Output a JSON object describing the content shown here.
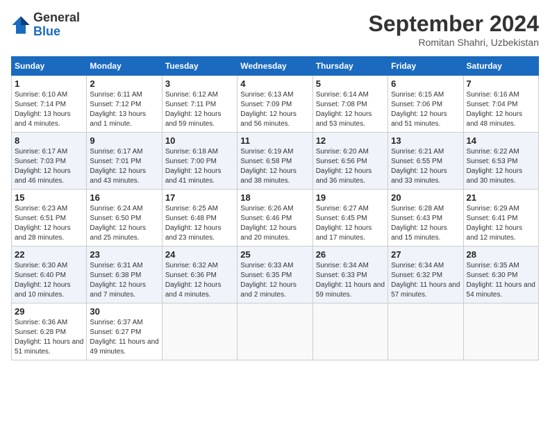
{
  "header": {
    "logo_general": "General",
    "logo_blue": "Blue",
    "month_title": "September 2024",
    "location": "Romitan Shahri, Uzbekistan"
  },
  "calendar": {
    "days_of_week": [
      "Sunday",
      "Monday",
      "Tuesday",
      "Wednesday",
      "Thursday",
      "Friday",
      "Saturday"
    ],
    "weeks": [
      [
        {
          "day": "1",
          "sunrise": "6:10 AM",
          "sunset": "7:14 PM",
          "daylight": "13 hours and 4 minutes."
        },
        {
          "day": "2",
          "sunrise": "6:11 AM",
          "sunset": "7:12 PM",
          "daylight": "13 hours and 1 minute."
        },
        {
          "day": "3",
          "sunrise": "6:12 AM",
          "sunset": "7:11 PM",
          "daylight": "12 hours and 59 minutes."
        },
        {
          "day": "4",
          "sunrise": "6:13 AM",
          "sunset": "7:09 PM",
          "daylight": "12 hours and 56 minutes."
        },
        {
          "day": "5",
          "sunrise": "6:14 AM",
          "sunset": "7:08 PM",
          "daylight": "12 hours and 53 minutes."
        },
        {
          "day": "6",
          "sunrise": "6:15 AM",
          "sunset": "7:06 PM",
          "daylight": "12 hours and 51 minutes."
        },
        {
          "day": "7",
          "sunrise": "6:16 AM",
          "sunset": "7:04 PM",
          "daylight": "12 hours and 48 minutes."
        }
      ],
      [
        {
          "day": "8",
          "sunrise": "6:17 AM",
          "sunset": "7:03 PM",
          "daylight": "12 hours and 46 minutes."
        },
        {
          "day": "9",
          "sunrise": "6:17 AM",
          "sunset": "7:01 PM",
          "daylight": "12 hours and 43 minutes."
        },
        {
          "day": "10",
          "sunrise": "6:18 AM",
          "sunset": "7:00 PM",
          "daylight": "12 hours and 41 minutes."
        },
        {
          "day": "11",
          "sunrise": "6:19 AM",
          "sunset": "6:58 PM",
          "daylight": "12 hours and 38 minutes."
        },
        {
          "day": "12",
          "sunrise": "6:20 AM",
          "sunset": "6:56 PM",
          "daylight": "12 hours and 36 minutes."
        },
        {
          "day": "13",
          "sunrise": "6:21 AM",
          "sunset": "6:55 PM",
          "daylight": "12 hours and 33 minutes."
        },
        {
          "day": "14",
          "sunrise": "6:22 AM",
          "sunset": "6:53 PM",
          "daylight": "12 hours and 30 minutes."
        }
      ],
      [
        {
          "day": "15",
          "sunrise": "6:23 AM",
          "sunset": "6:51 PM",
          "daylight": "12 hours and 28 minutes."
        },
        {
          "day": "16",
          "sunrise": "6:24 AM",
          "sunset": "6:50 PM",
          "daylight": "12 hours and 25 minutes."
        },
        {
          "day": "17",
          "sunrise": "6:25 AM",
          "sunset": "6:48 PM",
          "daylight": "12 hours and 23 minutes."
        },
        {
          "day": "18",
          "sunrise": "6:26 AM",
          "sunset": "6:46 PM",
          "daylight": "12 hours and 20 minutes."
        },
        {
          "day": "19",
          "sunrise": "6:27 AM",
          "sunset": "6:45 PM",
          "daylight": "12 hours and 17 minutes."
        },
        {
          "day": "20",
          "sunrise": "6:28 AM",
          "sunset": "6:43 PM",
          "daylight": "12 hours and 15 minutes."
        },
        {
          "day": "21",
          "sunrise": "6:29 AM",
          "sunset": "6:41 PM",
          "daylight": "12 hours and 12 minutes."
        }
      ],
      [
        {
          "day": "22",
          "sunrise": "6:30 AM",
          "sunset": "6:40 PM",
          "daylight": "12 hours and 10 minutes."
        },
        {
          "day": "23",
          "sunrise": "6:31 AM",
          "sunset": "6:38 PM",
          "daylight": "12 hours and 7 minutes."
        },
        {
          "day": "24",
          "sunrise": "6:32 AM",
          "sunset": "6:36 PM",
          "daylight": "12 hours and 4 minutes."
        },
        {
          "day": "25",
          "sunrise": "6:33 AM",
          "sunset": "6:35 PM",
          "daylight": "12 hours and 2 minutes."
        },
        {
          "day": "26",
          "sunrise": "6:34 AM",
          "sunset": "6:33 PM",
          "daylight": "11 hours and 59 minutes."
        },
        {
          "day": "27",
          "sunrise": "6:34 AM",
          "sunset": "6:32 PM",
          "daylight": "11 hours and 57 minutes."
        },
        {
          "day": "28",
          "sunrise": "6:35 AM",
          "sunset": "6:30 PM",
          "daylight": "11 hours and 54 minutes."
        }
      ],
      [
        {
          "day": "29",
          "sunrise": "6:36 AM",
          "sunset": "6:28 PM",
          "daylight": "11 hours and 51 minutes."
        },
        {
          "day": "30",
          "sunrise": "6:37 AM",
          "sunset": "6:27 PM",
          "daylight": "11 hours and 49 minutes."
        },
        null,
        null,
        null,
        null,
        null
      ]
    ]
  }
}
